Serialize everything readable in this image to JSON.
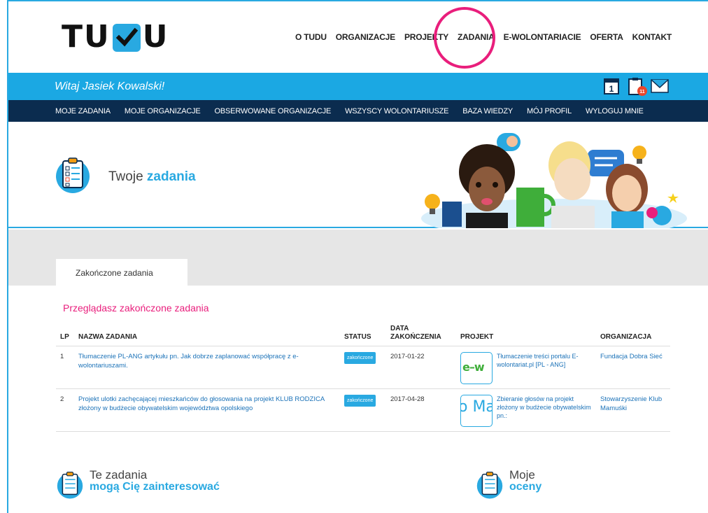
{
  "logo": {
    "text_left": "TU",
    "text_right": "U"
  },
  "main_nav": [
    "O TUDU",
    "ORGANIZACJE",
    "PROJEKTY",
    "ZADANIA",
    "E-WOLONTARIACIE",
    "OFERTA",
    "KONTAKT"
  ],
  "welcome": "Witaj Jasiek Kowalski!",
  "header_icons": {
    "calendar_number": "1",
    "notification_count": "11"
  },
  "sub_nav": [
    "MOJE ZADANIA",
    "MOJE ORGANIZACJE",
    "OBSERWOWANE ORGANIZACJE",
    "WSZYSCY WOLONTARIUSZE",
    "BAZA WIEDZY",
    "MÓJ PROFIL",
    "WYLOGUJ MNIE"
  ],
  "hero": {
    "title_prefix": "Twoje",
    "title_highlight": "zadania"
  },
  "tabs": [
    "Zakończone zadania"
  ],
  "browsing_text": "Przeglądasz zakończone zadania",
  "table": {
    "headers": {
      "lp": "LP",
      "name": "NAZWA ZADANIA",
      "status": "STATUS",
      "date_l1": "DATA",
      "date_l2": "ZAKOŃCZENIA",
      "project": "PROJEKT",
      "org": "ORGANIZACJA"
    },
    "rows": [
      {
        "lp": "1",
        "name": "Tłumaczenie PL-ANG artykułu pn. Jak dobrze zaplanować współpracę z e-wolontariuszami.",
        "status": "zakończone",
        "date": "2017-01-22",
        "thumb_text": "e–w",
        "project": "Tłumaczenie treści portalu E-wolontariat.pl [PL - ANG]",
        "org": "Fundacja Dobra Sieć"
      },
      {
        "lp": "2",
        "name": "Projekt ulotki zachęcającej mieszkańców do głosowania na projekt KLUB RODZICA złożony w budżecie obywatelskim województwa opolskiego",
        "status": "zakończone",
        "date": "2017-04-28",
        "thumb_text": "o Ma",
        "project": "Zbieranie głosów na projekt złożony w budżecie obywatelskim pn.:",
        "org": "Stowarzyszenie Klub Mamuśki"
      }
    ]
  },
  "bottom_left": {
    "line1": "Te zadania",
    "line2": "mogą Cię zainteresować"
  },
  "bottom_right": {
    "line1": "Moje",
    "line2": "oceny"
  },
  "colors": {
    "accent": "#29a9e1",
    "navy": "#0b2c4f",
    "pink": "#e91e7c",
    "gray": "#e6e6e6"
  }
}
